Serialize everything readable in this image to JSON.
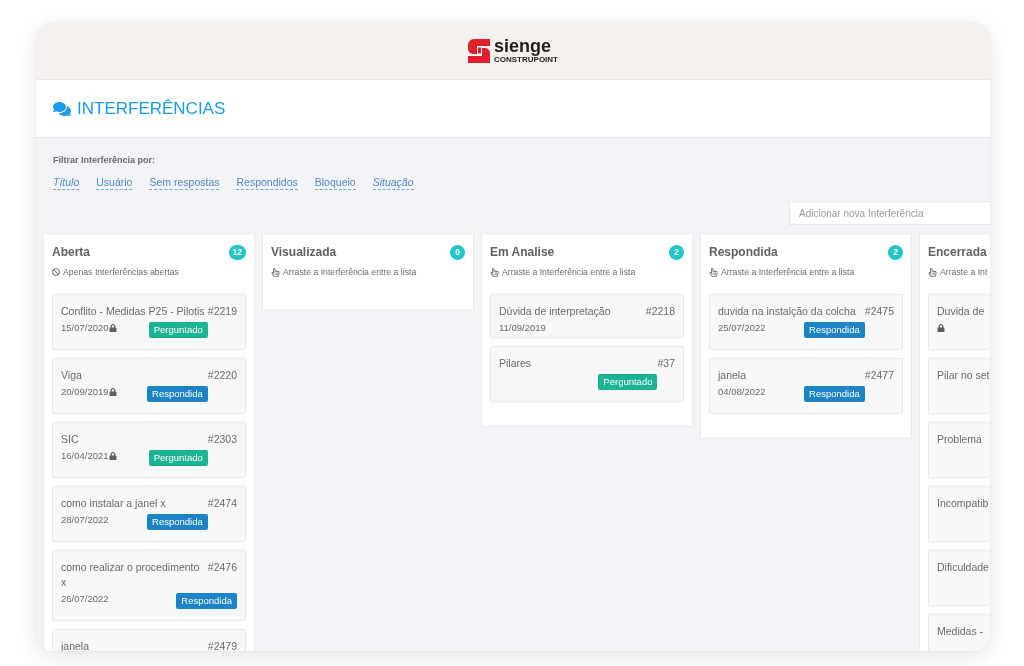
{
  "header": {
    "logo_name": "sienge",
    "logo_tagline": "CONSTRUPOINT"
  },
  "page_title": "INTERFERÊNCIAS",
  "filter": {
    "label": "Filtrar Interferência por:",
    "links": [
      {
        "label": "Título",
        "italic": true
      },
      {
        "label": "Usuário",
        "italic": false
      },
      {
        "label": "Sem respostas",
        "italic": false
      },
      {
        "label": "Respondidos",
        "italic": false
      },
      {
        "label": "Bloqueio",
        "italic": false
      },
      {
        "label": "Situação",
        "italic": true
      }
    ]
  },
  "new_item": {
    "placeholder": "Adicionar nova Interferência"
  },
  "columns": [
    {
      "title": "Aberta",
      "count": "12",
      "kind": "restricted",
      "hint": "Apenas Interferências abertas",
      "cut_off": false,
      "cards": [
        {
          "title": "Conflito - Medidas P25 - Pilotis",
          "number": "#2219",
          "date": "15/07/2020",
          "locked": true,
          "status": {
            "label": "Perguntado",
            "color": "#1ab394"
          }
        },
        {
          "title": "Viga",
          "number": "#2220",
          "date": "20/09/2019",
          "locked": true,
          "status": {
            "label": "Respondida",
            "color": "#1c84c6"
          }
        },
        {
          "title": "SIC",
          "number": "#2303",
          "date": "16/04/2021",
          "locked": true,
          "status": {
            "label": "Perguntado",
            "color": "#1ab394"
          }
        },
        {
          "title": "como instalar a janel x",
          "number": "#2474",
          "date": "28/07/2022",
          "locked": false,
          "status": {
            "label": "Respondida",
            "color": "#1c84c6"
          }
        },
        {
          "title": "como realizar o procedimento x",
          "number": "#2476",
          "date": "26/07/2022",
          "locked": false,
          "status": {
            "label": "Respondida",
            "color": "#1c84c6"
          }
        },
        {
          "title": "janela",
          "number": "#2479",
          "locked": false
        }
      ]
    },
    {
      "title": "Visualizada",
      "count": "0",
      "kind": "draggable",
      "hint": "Arraste a Interferência entre a lista",
      "cut_off": false
    },
    {
      "title": "Em Analise",
      "count": "2",
      "kind": "draggable",
      "hint": "Arraste a Interferência entre a lista",
      "cut_off": false,
      "cards": [
        {
          "title": "Dúvida de interpretação",
          "number": "#2218",
          "date": "11/09/2019",
          "locked": false
        },
        {
          "title": "Pilares",
          "number": "#37",
          "locked": false,
          "status": {
            "label": "Perguntado",
            "color": "#1ab394"
          }
        }
      ]
    },
    {
      "title": "Respondida",
      "count": "2",
      "kind": "draggable",
      "hint": "Arraste a Interferência entre a lista",
      "cut_off": false,
      "cards": [
        {
          "title": "duvida na instalção da colcha",
          "number": "#2475",
          "date": "25/07/2022",
          "locked": false,
          "status": {
            "label": "Respondida",
            "color": "#1c84c6"
          }
        },
        {
          "title": "janela",
          "number": "#2477",
          "date": "04/08/2022",
          "locked": false,
          "status": {
            "label": "Respondida",
            "color": "#1c84c6"
          }
        }
      ]
    },
    {
      "title": "Encerrada",
      "kind": "draggable",
      "hint": "Arraste a Int",
      "cut_off": true,
      "cards": [
        {
          "title": "Duvida de",
          "locked": true
        },
        {
          "title": "Pilar no set",
          "locked": false
        },
        {
          "title": "Problema",
          "locked": false
        },
        {
          "title": "Incompatib",
          "locked": false
        },
        {
          "title": "Dificuldade",
          "locked": false
        },
        {
          "title": "Medidas -",
          "locked": false
        }
      ]
    }
  ]
}
